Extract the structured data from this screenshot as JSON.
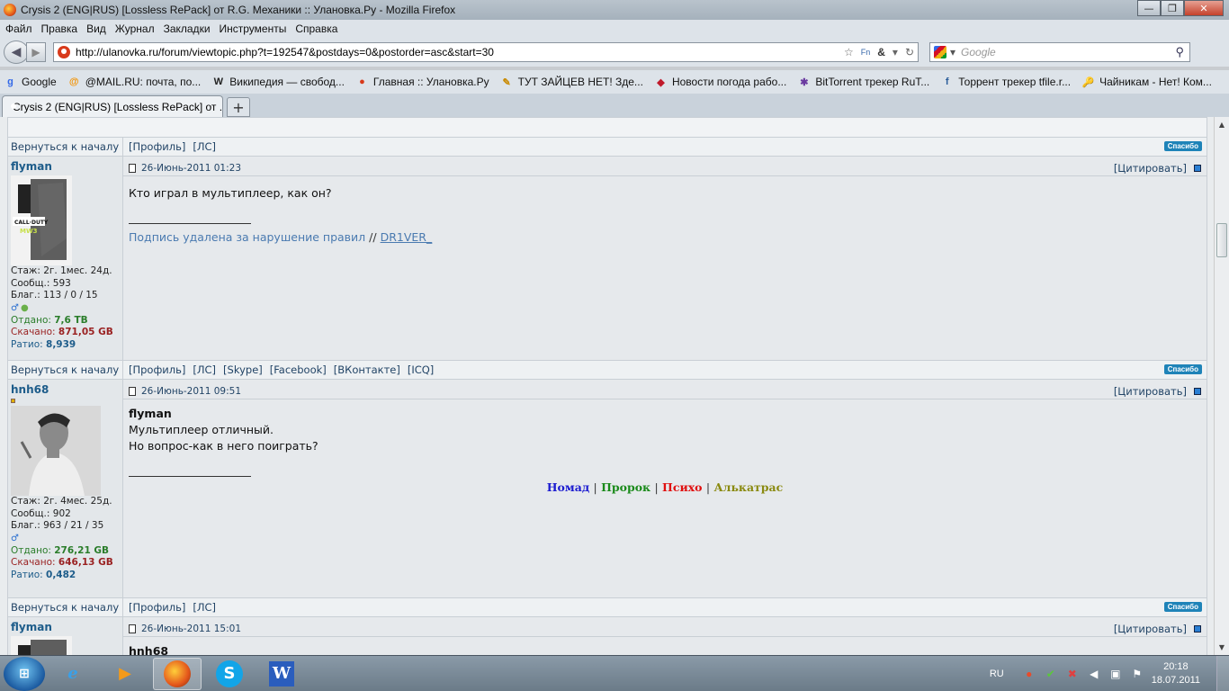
{
  "window": {
    "title": "Crysis 2 (ENG|RUS) [Lossless RePack] от R.G. Механики :: Улановка.Ру - Mozilla Firefox",
    "min": "—",
    "max": "❐",
    "close": "✕"
  },
  "menu": [
    "Файл",
    "Правка",
    "Вид",
    "Журнал",
    "Закладки",
    "Инструменты",
    "Справка"
  ],
  "nav": {
    "back": "◀",
    "forward": "▶",
    "url": "http://ulanovka.ru/forum/viewtopic.php?t=192547&postdays=0&postorder=asc&start=30",
    "star": "☆",
    "lang_badge": "Fn",
    "amp": "&",
    "dropdown": "▾",
    "reload": "↻",
    "search_placeholder": "Google",
    "search_go": "⚲"
  },
  "bookmarks": [
    {
      "icon": "g",
      "label": "Google",
      "color": "#3369e8"
    },
    {
      "icon": "@",
      "label": "@MAIL.RU: почта, по...",
      "color": "#f39200"
    },
    {
      "icon": "W",
      "label": "Википедия — свобод...",
      "color": "#222222"
    },
    {
      "icon": "●",
      "label": "Главная :: Улановка.Ру",
      "color": "#d83a1b"
    },
    {
      "icon": "✎",
      "label": "ТУТ ЗАЙЦЕВ НЕТ! Зде...",
      "color": "#c98a00"
    },
    {
      "icon": "◆",
      "label": "Новости погода рабо...",
      "color": "#c01a2b"
    },
    {
      "icon": "✱",
      "label": "BitTorrent трекер RuT...",
      "color": "#6a3aa0"
    },
    {
      "icon": "f",
      "label": "Торрент трекер tfile.r...",
      "color": "#2a5d9a"
    },
    {
      "icon": "🔑",
      "label": "Чайникам - Нет! Ком...",
      "color": "#d9a400"
    }
  ],
  "tab": {
    "label": "Crysis 2 (ENG|RUS) [Lossless RePack] от ...",
    "new": "+"
  },
  "nav_rows": [
    {
      "back": "Вернуться к началу",
      "links": [
        "[Профиль]",
        "[ЛС]"
      ],
      "thanks": "Спасибо"
    },
    {
      "back": "Вернуться к началу",
      "links": [
        "[Профиль]",
        "[ЛС]",
        "[Skype]",
        "[Facebook]",
        "[ВКонтакте]",
        "[ICQ]"
      ],
      "thanks": "Спасибо"
    },
    {
      "back": "Вернуться к началу",
      "links": [
        "[Профиль]",
        "[ЛС]"
      ],
      "thanks": "Спасибо"
    }
  ],
  "posts": [
    {
      "user": "flyman",
      "date": "26-Июнь-2011 01:23",
      "quote": "[Цитировать]",
      "stats": {
        "stazh": "Стаж: 2г. 1мес. 24д.",
        "messages": "Сообщ.: 593",
        "blag": "Благ.: 113 / 0 / 15",
        "up_label": "Отдано:",
        "up": "7,6 TB",
        "down_label": "Скачано:",
        "down": "871,05 GB",
        "ratio_label": "Ратио:",
        "ratio": "8,939"
      },
      "body": [
        "Кто играл в мультиплеер, как он?"
      ],
      "sig": {
        "text": "Подпись удалена за нарушение правил",
        "sep": "//",
        "author": "DR1VER_"
      }
    },
    {
      "user": "hnh68",
      "date": "26-Июнь-2011 09:51",
      "quote": "[Цитировать]",
      "stats": {
        "stazh": "Стаж: 2г. 4мес. 25д.",
        "messages": "Сообщ.: 902",
        "blag": "Благ.: 963 / 21 / 35",
        "up_label": "Отдано:",
        "up": "276,21 GB",
        "down_label": "Скачано:",
        "down": "646,13 GB",
        "ratio_label": "Ратио:",
        "ratio": "0,482"
      },
      "quoted_user": "flyman",
      "body": [
        "Мультиплеер отличный.",
        "Но вопрос-как в него поиграть?"
      ],
      "roles": [
        {
          "label": "Номад",
          "color": "#1b1bd0"
        },
        {
          "label": "Пророк",
          "color": "#1a8a1a"
        },
        {
          "label": "Психо",
          "color": "#e01010"
        },
        {
          "label": "Алькатрас",
          "color": "#8a8a10"
        }
      ],
      "role_sep": "|"
    },
    {
      "user": "flyman",
      "date": "26-Июнь-2011 15:01",
      "quote": "[Цитировать]",
      "quoted_user": "hnh68"
    }
  ],
  "taskbar": {
    "start": "⊞",
    "items": [
      "e",
      "▶",
      "",
      "S",
      "W"
    ],
    "lang": "RU",
    "time": "20:18",
    "date": "18.07.2011"
  }
}
